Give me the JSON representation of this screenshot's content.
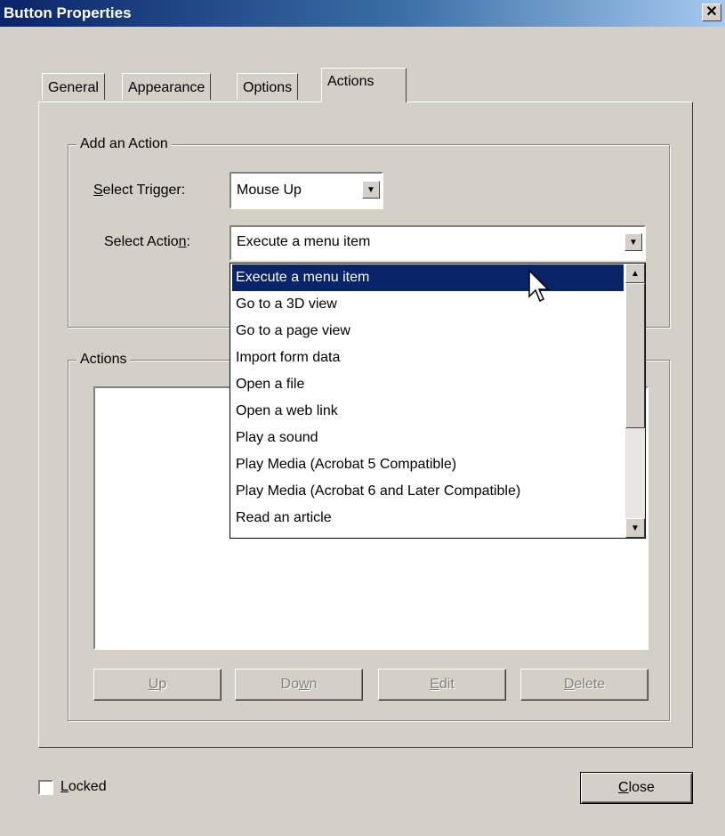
{
  "window": {
    "title": "Button Properties",
    "close_glyph": "✕"
  },
  "tabs": [
    {
      "label": "General"
    },
    {
      "label": "Appearance"
    },
    {
      "label": "Options"
    },
    {
      "label": "Actions",
      "active": true
    }
  ],
  "add_action": {
    "legend": "Add an Action",
    "trigger_label_pre": "",
    "trigger_label_ul": "S",
    "trigger_label_post": "elect Trigger:",
    "trigger_value": "Mouse Up",
    "action_label_pre": "Select Actio",
    "action_label_ul": "n",
    "action_label_post": ":",
    "action_value": "Execute a menu item"
  },
  "action_list": {
    "selected_index": 0,
    "items": [
      "Execute a menu item",
      "Go to a 3D view",
      "Go to a page view",
      "Import form data",
      "Open a file",
      "Open a web link",
      "Play a sound",
      "Play Media (Acrobat 5 Compatible)",
      "Play Media (Acrobat 6 and Later Compatible)",
      "Read an article"
    ]
  },
  "actions_group": {
    "legend": "Actions"
  },
  "buttons": {
    "up": {
      "pre": "",
      "ul": "U",
      "post": "p"
    },
    "down": {
      "pre": "Do",
      "ul": "w",
      "post": "n"
    },
    "edit": {
      "pre": "",
      "ul": "E",
      "post": "dit"
    },
    "delete": {
      "pre": "",
      "ul": "D",
      "post": "elete"
    },
    "close": {
      "pre": "",
      "ul": "C",
      "post": "lose"
    }
  },
  "locked": {
    "pre": "",
    "ul": "L",
    "post": "ocked",
    "checked": false
  },
  "colors": {
    "selection": "#0a246a",
    "dialog_bg": "#d4d0c8",
    "title_start": "#0a246a",
    "title_end": "#a6caf0"
  }
}
